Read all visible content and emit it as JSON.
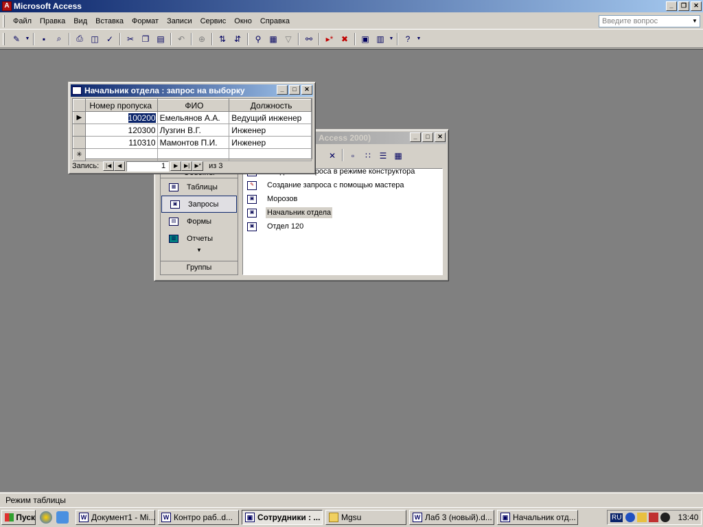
{
  "app": {
    "title": "Microsoft Access",
    "icon": "access-icon"
  },
  "menu": [
    "Файл",
    "Правка",
    "Вид",
    "Вставка",
    "Формат",
    "Записи",
    "Сервис",
    "Окно",
    "Справка"
  ],
  "question_placeholder": "Введите вопрос",
  "toolbar_icons": [
    "design-view-icon",
    "save-icon",
    "print-preview-icon",
    "print-icon",
    "spelling-icon",
    "cut-icon",
    "copy-icon",
    "paste-icon",
    "undo-icon",
    "hyperlink-icon",
    "sort-asc-icon",
    "sort-desc-icon",
    "filter-by-selection-icon",
    "filter-by-form-icon",
    "apply-filter-icon",
    "find-icon",
    "new-record-icon",
    "delete-record-icon",
    "database-window-icon",
    "new-object-icon",
    "help-icon"
  ],
  "db_window": {
    "title_fragment": "Access 2000)",
    "objects_header": "Объекты",
    "objects": [
      "Таблицы",
      "Запросы",
      "Формы",
      "Отчеты"
    ],
    "selected_object": "Запросы",
    "groups_label": "Группы",
    "items": [
      "Создание запроса в режиме конструктора",
      "Создание запроса с помощью мастера",
      "Морозов",
      "Начальник отдела",
      "Отдел 120"
    ],
    "highlighted_item": "Начальник отдела"
  },
  "query_window": {
    "title": "Начальник отдела : запрос на выборку",
    "columns": [
      "Номер пропуска",
      "ФИО",
      "Должность"
    ],
    "rows": [
      [
        "100200",
        "Емельянов А.А.",
        "Ведущий инженер"
      ],
      [
        "120300",
        "Лузгин В.Г.",
        "Инженер"
      ],
      [
        "110310",
        "Мамонтов П.И.",
        "Инженер"
      ]
    ],
    "nav": {
      "label": "Запись:",
      "current": "1",
      "of_label": "из 3"
    }
  },
  "status": "Режим таблицы",
  "taskbar": {
    "start_label": "Пуск",
    "tasks": [
      "Документ1 - Mi...",
      "Контро раб..d...",
      "Сотрудники : ...",
      "Mgsu",
      "Лаб 3 (новый).d...",
      "Начальник отд..."
    ],
    "active_task": "Сотрудники : ...",
    "tray_lang": "RU",
    "clock": "13:40"
  }
}
